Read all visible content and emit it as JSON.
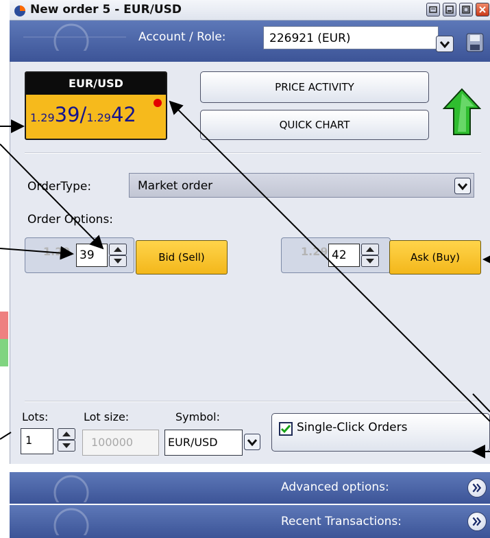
{
  "window": {
    "title": "New order 5 - EUR/USD"
  },
  "account": {
    "label": "Account / Role:",
    "value": "226921 (EUR)"
  },
  "quote": {
    "symbol": "EUR/USD",
    "bid_small": "1.29",
    "bid_big": "39",
    "separator": "/",
    "ask_small": "1.29",
    "ask_big": "42"
  },
  "buttons": {
    "price_activity": "PRICE ACTIVITY",
    "quick_chart": "QUICK CHART"
  },
  "order": {
    "type_label": "OrderType:",
    "type_value": "Market order",
    "options_label": "Order Options:"
  },
  "bid": {
    "prefix": "1.29",
    "value": "39",
    "button": "Bid (Sell)"
  },
  "ask": {
    "prefix": "1.29",
    "value": "42",
    "button": "Ask (Buy)"
  },
  "bottom": {
    "lots_label": "Lots:",
    "lots_value": "1",
    "lot_size_label": "Lot size:",
    "lot_size_value": "100000",
    "symbol_label": "Symbol:",
    "symbol_value": "EUR/USD",
    "single_click_label": "Single-Click Orders",
    "single_click_checked": true
  },
  "sections": {
    "advanced": "Advanced options:",
    "recent": "Recent Transactions:"
  },
  "colors": {
    "band": "#4560a3",
    "tile": "#f6ba1c",
    "price": "#14148c",
    "arrow": "#2fbd2f"
  }
}
